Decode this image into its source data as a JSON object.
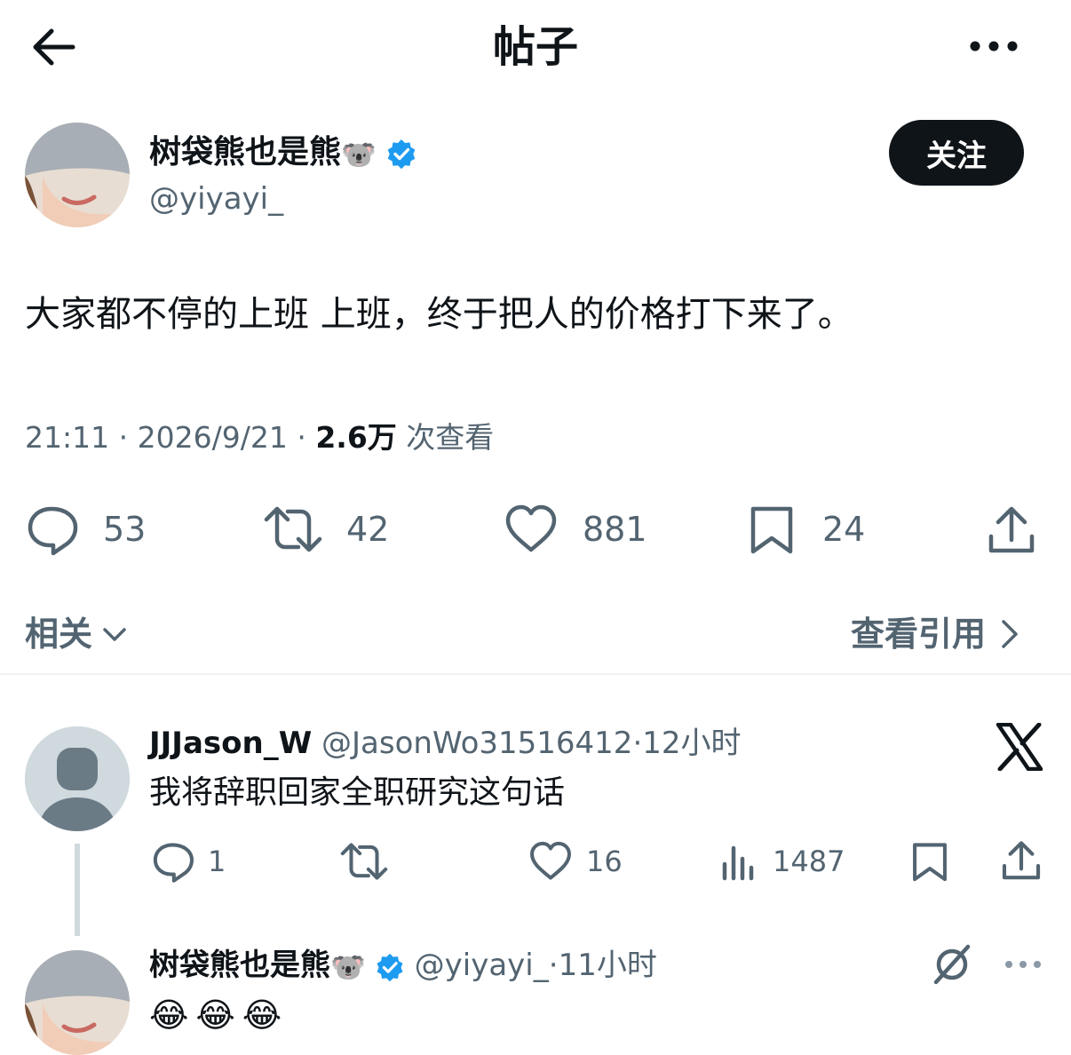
{
  "header": {
    "title": "帖子",
    "back_icon": "arrow-left-icon",
    "more_icon": "more-horizontal-icon"
  },
  "post": {
    "author_name": "树袋熊也是熊",
    "author_emoji": "🐨",
    "author_handle": "@yiyayi_",
    "follow_label": "关注",
    "text": "大家都不停的上班 上班，终于把人的价格打下来了。",
    "time": "21:11",
    "date": "2026/9/21",
    "views_count": "2.6万",
    "views_label": "次查看",
    "separator": "·",
    "stats": {
      "replies": "53",
      "reposts": "42",
      "likes": "881",
      "bookmarks": "24"
    }
  },
  "nav": {
    "related_label": "相关",
    "quotes_label": "查看引用"
  },
  "replies": [
    {
      "author_name": "JJJason_W",
      "author_handle": "@JasonWo31516412",
      "time": "12小时",
      "text": "我将辞职回家全职研究这句话",
      "stats": {
        "replies": "1",
        "likes": "16",
        "views": "1487"
      }
    },
    {
      "author_name": "树袋熊也是熊",
      "author_emoji": "🐨",
      "author_handle": "@yiyayi_",
      "time": "11小时",
      "text": "😂😂😂"
    }
  ],
  "colors": {
    "text": "#0f1419",
    "muted": "#536471",
    "verified": "#1d9bf0",
    "button_bg": "#0f1419",
    "divider": "#eff3f4"
  }
}
